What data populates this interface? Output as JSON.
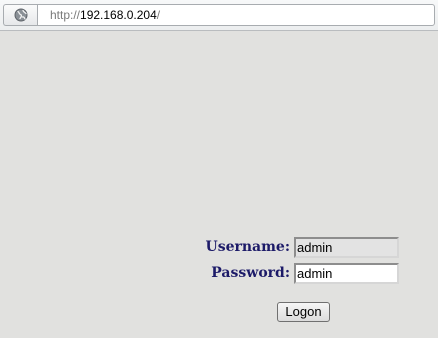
{
  "browser": {
    "url_scheme": "http://",
    "url_host": "192.168.0.204",
    "url_path": "/",
    "site_icon": "globe-icon"
  },
  "login": {
    "username_label": "Username:",
    "username_value": "admin",
    "password_label": "Password:",
    "password_value": "admin",
    "submit_label": "Logon"
  }
}
